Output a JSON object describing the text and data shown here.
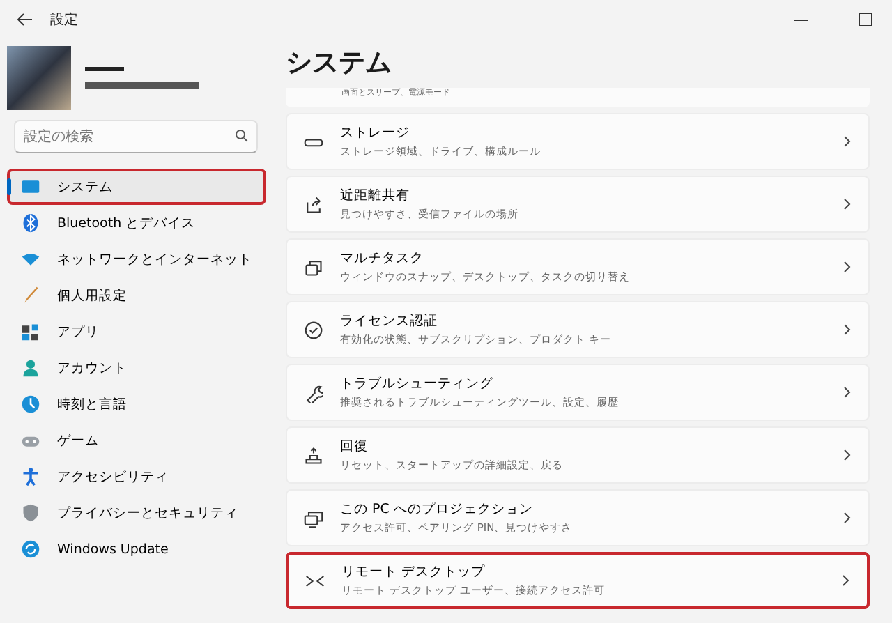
{
  "window": {
    "title": "設定"
  },
  "search": {
    "placeholder": "設定の検索"
  },
  "sidebar": {
    "items": [
      {
        "label": "システム",
        "selected": true,
        "highlighted": true
      },
      {
        "label": "Bluetooth とデバイス",
        "selected": false,
        "highlighted": false
      },
      {
        "label": "ネットワークとインターネット",
        "selected": false,
        "highlighted": false
      },
      {
        "label": "個人用設定",
        "selected": false,
        "highlighted": false
      },
      {
        "label": "アプリ",
        "selected": false,
        "highlighted": false
      },
      {
        "label": "アカウント",
        "selected": false,
        "highlighted": false
      },
      {
        "label": "時刻と言語",
        "selected": false,
        "highlighted": false
      },
      {
        "label": "ゲーム",
        "selected": false,
        "highlighted": false
      },
      {
        "label": "アクセシビリティ",
        "selected": false,
        "highlighted": false
      },
      {
        "label": "プライバシーとセキュリティ",
        "selected": false,
        "highlighted": false
      },
      {
        "label": "Windows Update",
        "selected": false,
        "highlighted": false
      }
    ]
  },
  "page": {
    "title": "システム",
    "partial_card": {
      "description": "画面とスリープ、電源モード"
    },
    "cards": [
      {
        "title": "ストレージ",
        "description": "ストレージ領域、ドライブ、構成ルール",
        "highlighted": false
      },
      {
        "title": "近距離共有",
        "description": "見つけやすさ、受信ファイルの場所",
        "highlighted": false
      },
      {
        "title": "マルチタスク",
        "description": "ウィンドウのスナップ、デスクトップ、タスクの切り替え",
        "highlighted": false
      },
      {
        "title": "ライセンス認証",
        "description": "有効化の状態、サブスクリプション、プロダクト キー",
        "highlighted": false
      },
      {
        "title": "トラブルシューティング",
        "description": "推奨されるトラブルシューティングツール、設定、履歴",
        "highlighted": false
      },
      {
        "title": "回復",
        "description": "リセット、スタートアップの詳細設定、戻る",
        "highlighted": false
      },
      {
        "title": "この PC へのプロジェクション",
        "description": "アクセス許可、ペアリング PIN、見つけやすさ",
        "highlighted": false
      },
      {
        "title": "リモート デスクトップ",
        "description": "リモート デスクトップ ユーザー、接続アクセス許可",
        "highlighted": true
      }
    ]
  }
}
